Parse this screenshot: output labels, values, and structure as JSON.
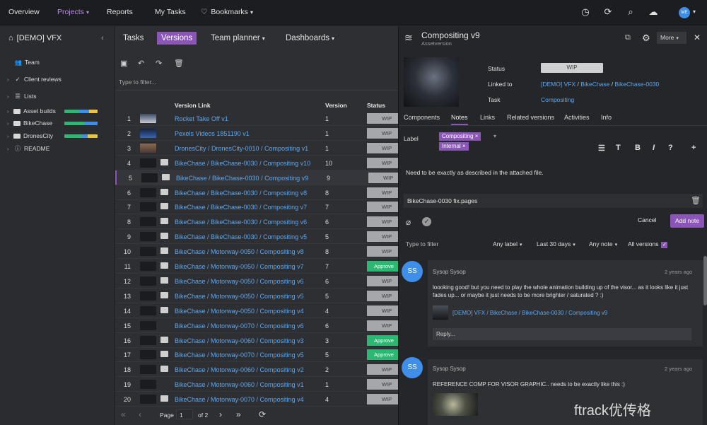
{
  "topbar": {
    "nav": [
      "Overview",
      "Projects",
      "Reports",
      "My Tasks",
      "Bookmarks"
    ],
    "active_nav": "Projects",
    "avatar": "ME"
  },
  "sidebar": {
    "project": "[DEMO] VFX",
    "items": [
      "Team",
      "Client reviews",
      "Lists",
      "Asset builds",
      "BikeChase",
      "DronesCity",
      "README"
    ],
    "bar_colors": [
      "#2cb872",
      "#3f8ee8",
      "#e8c43f"
    ]
  },
  "main": {
    "tabs": [
      "Tasks",
      "Versions",
      "Team planner",
      "Dashboards"
    ],
    "active_tab": "Versions",
    "filter_placeholder": "Type to filter...",
    "columns": {
      "link": "Version Link",
      "version": "Version",
      "status": "Status"
    },
    "rows": [
      {
        "n": "1",
        "thumb": "sky",
        "comment": false,
        "link": "Rocket Take Off v1",
        "version": "1",
        "status": "WIP"
      },
      {
        "n": "2",
        "thumb": "blu",
        "comment": false,
        "link": "Pexels Videos 1851190 v1",
        "version": "1",
        "status": "WIP"
      },
      {
        "n": "3",
        "thumb": "bro",
        "comment": false,
        "link": "DronesCity / DronesCity-0010 / Compositing v1",
        "version": "1",
        "status": "WIP"
      },
      {
        "n": "4",
        "thumb": "dark",
        "comment": true,
        "link": "BikeChase / BikeChase-0030 / Compositing v10",
        "version": "10",
        "status": "WIP"
      },
      {
        "n": "5",
        "thumb": "dark",
        "comment": true,
        "link": "BikeChase / BikeChase-0030 / Compositing v9",
        "version": "9",
        "status": "WIP"
      },
      {
        "n": "6",
        "thumb": "dark",
        "comment": true,
        "link": "BikeChase / BikeChase-0030 / Compositing v8",
        "version": "8",
        "status": "WIP"
      },
      {
        "n": "7",
        "thumb": "dark",
        "comment": true,
        "link": "BikeChase / BikeChase-0030 / Compositing v7",
        "version": "7",
        "status": "WIP"
      },
      {
        "n": "8",
        "thumb": "dark",
        "comment": true,
        "link": "BikeChase / BikeChase-0030 / Compositing v6",
        "version": "6",
        "status": "WIP"
      },
      {
        "n": "9",
        "thumb": "dark",
        "comment": true,
        "link": "BikeChase / BikeChase-0030 / Compositing v5",
        "version": "5",
        "status": "WIP"
      },
      {
        "n": "10",
        "thumb": "dark",
        "comment": true,
        "link": "BikeChase / Motorway-0050 / Compositing v8",
        "version": "8",
        "status": "WIP"
      },
      {
        "n": "11",
        "thumb": "dark",
        "comment": true,
        "link": "BikeChase / Motorway-0050 / Compositing v7",
        "version": "7",
        "status": "Approve"
      },
      {
        "n": "12",
        "thumb": "dark",
        "comment": true,
        "link": "BikeChase / Motorway-0050 / Compositing v6",
        "version": "6",
        "status": "WIP"
      },
      {
        "n": "13",
        "thumb": "dark",
        "comment": true,
        "link": "BikeChase / Motorway-0050 / Compositing v5",
        "version": "5",
        "status": "WIP"
      },
      {
        "n": "14",
        "thumb": "dark",
        "comment": true,
        "link": "BikeChase / Motorway-0050 / Compositing v4",
        "version": "4",
        "status": "WIP"
      },
      {
        "n": "15",
        "thumb": "dark",
        "comment": false,
        "link": "BikeChase / Motorway-0070 / Compositing v6",
        "version": "6",
        "status": "WIP"
      },
      {
        "n": "16",
        "thumb": "dark",
        "comment": true,
        "link": "BikeChase / Motorway-0060 / Compositing v3",
        "version": "3",
        "status": "Approve"
      },
      {
        "n": "17",
        "thumb": "dark",
        "comment": true,
        "link": "BikeChase / Motorway-0070 / Compositing v5",
        "version": "5",
        "status": "Approve"
      },
      {
        "n": "18",
        "thumb": "dark",
        "comment": true,
        "link": "BikeChase / Motorway-0060 / Compositing v2",
        "version": "2",
        "status": "WIP"
      },
      {
        "n": "19",
        "thumb": "dark",
        "comment": false,
        "link": "BikeChase / Motorway-0060 / Compositing v1",
        "version": "1",
        "status": "WIP"
      },
      {
        "n": "20",
        "thumb": "dark",
        "comment": true,
        "link": "BikeChase / Motorway-0070 / Compositing v4",
        "version": "4",
        "status": "WIP"
      }
    ],
    "selected_row": "5",
    "pager": {
      "label": "Page",
      "page": "1",
      "of": "of 2"
    }
  },
  "panel": {
    "title": "Compositing v9",
    "subtitle": "Assetversion",
    "more": "More",
    "fields": {
      "status_label": "Status",
      "status_value": "WIP",
      "linked_label": "Linked to",
      "linked_1": "[DEMO] VFX",
      "linked_2": "BikeChase",
      "linked_3": "BikeChase-0030",
      "task_label": "Task",
      "task_value": "Compositing"
    },
    "tabs": [
      "Components",
      "Notes",
      "Links",
      "Related versions",
      "Activities",
      "Info"
    ],
    "active_tab": "Notes",
    "label_title": "Label",
    "chips": [
      "Compositing",
      "Internal"
    ],
    "note_text": "Need to be exactly as described in the attached file.",
    "attachment": "BikeChase-0030 fix.pages",
    "cancel": "Cancel",
    "add_note": "Add note",
    "filter_placeholder": "Type to filter",
    "filters": [
      "Any label",
      "Last 30 days",
      "Any note",
      "All versions"
    ],
    "notes": [
      {
        "initials": "SS",
        "author": "Sysop Sysop",
        "time": "2 years ago",
        "text": "loooking good! but you need to play the whole animation building up of the visor... as it looks like it just fades up... or maybe it just needs to be more brighter / saturated ? :)",
        "link": "[DEMO] VFX / BikeChase / BikeChase-0030 / Compositing v9",
        "reply": "Reply..."
      },
      {
        "initials": "SS",
        "author": "Sysop Sysop",
        "time": "2 years ago",
        "text": "REFERENCE COMP FOR VISOR GRAPHIC.. needs to be exactly like this :)"
      }
    ]
  },
  "watermark": "ftrack优传格"
}
